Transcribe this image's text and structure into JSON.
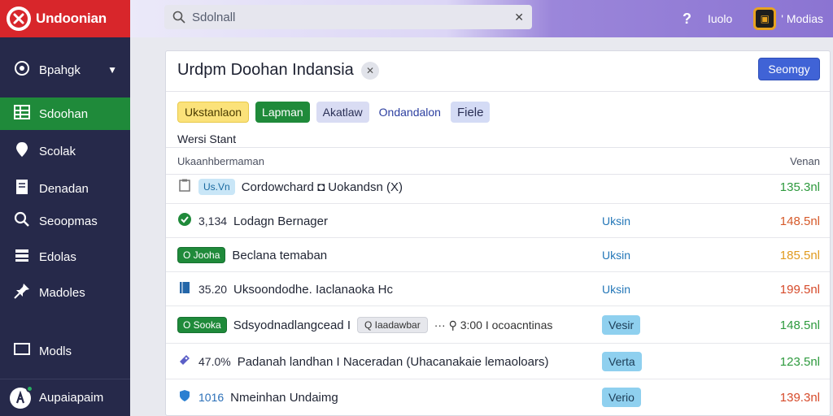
{
  "app": {
    "name": "Undoonian",
    "logo_icon": "brand-logo-icon"
  },
  "search": {
    "value": "Sdolnall",
    "icon": "search-icon"
  },
  "topbar": {
    "help_icon": "?",
    "help_label": "Iuolo",
    "user_label": "' Modias"
  },
  "sidebar": {
    "items": [
      {
        "label": "Bpahgk",
        "icon": "gauge-icon",
        "has_chevron": true
      },
      {
        "label": "Sdoohan",
        "icon": "grid-icon",
        "active": true
      },
      {
        "label": "Scolak",
        "icon": "pin-icon"
      },
      {
        "label": "Denadan",
        "icon": "document-icon"
      },
      {
        "label": "Seoopmas",
        "icon": "search-icon"
      },
      {
        "label": "Edolas",
        "icon": "layers-icon"
      },
      {
        "label": "Madoles",
        "icon": "pushpin-icon"
      },
      {
        "label": "Modls",
        "icon": "monitor-icon"
      }
    ],
    "footer": {
      "label": "Aupaiapaim"
    }
  },
  "card": {
    "title": "Urdpm Doohan Indansia",
    "primary_button": "Seomgy",
    "chips": [
      "Ukstanlaon",
      "Lapman",
      "Akatlaw",
      "Ondandalon",
      "Fiele"
    ],
    "section_label": "Wersi Stant",
    "table": {
      "header_left": "Ukaanhbermaman",
      "header_right": "Venan",
      "rows": [
        {
          "icon": "clipboard-icon",
          "badge": "Us.Vn",
          "text": "Cordowchard ◘ Uokandsn (X)",
          "status": "",
          "value": "135.3nl",
          "value_color": "#2e9a3e"
        },
        {
          "icon": "check-circle-icon",
          "number": "3,134",
          "text": "Lodagn Bernager",
          "status": "Uksin",
          "value": "148.5nl",
          "value_color": "#d65a2a"
        },
        {
          "icon": "",
          "badge_green": "O Jooha",
          "text": "Beclana temaban",
          "status": "Uksin",
          "value": "185.5nl",
          "value_color": "#e09a1e"
        },
        {
          "icon": "book-icon",
          "number": "35.20",
          "text": "Uksoondodhe. Iaclanaoka Hc",
          "status": "Uksin",
          "value": "199.5nl",
          "value_color": "#d64a2a"
        },
        {
          "icon": "",
          "badge_green": "O Sooka",
          "text": "Sdsyodnadlangcead I",
          "tag": "Q Iaadawbar",
          "extra": "··· ⚲ 3:00 I ocoacntinas",
          "status_chip": "Vesir",
          "value": "148.5nl",
          "value_color": "#2e9a3e"
        },
        {
          "icon": "tag-icon",
          "number": "47.0%",
          "text": "Padanah landhan  I  Naceradan (Uhacanakaie lemaoloars)",
          "status_chip": "Verta",
          "value": "123.5nl",
          "value_color": "#2e9a3e"
        },
        {
          "icon": "shield-icon",
          "number": "1016",
          "text": "Nmeinhan Undaimg",
          "status_chip": "Verio",
          "value": "139.3nl",
          "value_color": "#d64a2a"
        }
      ]
    }
  }
}
